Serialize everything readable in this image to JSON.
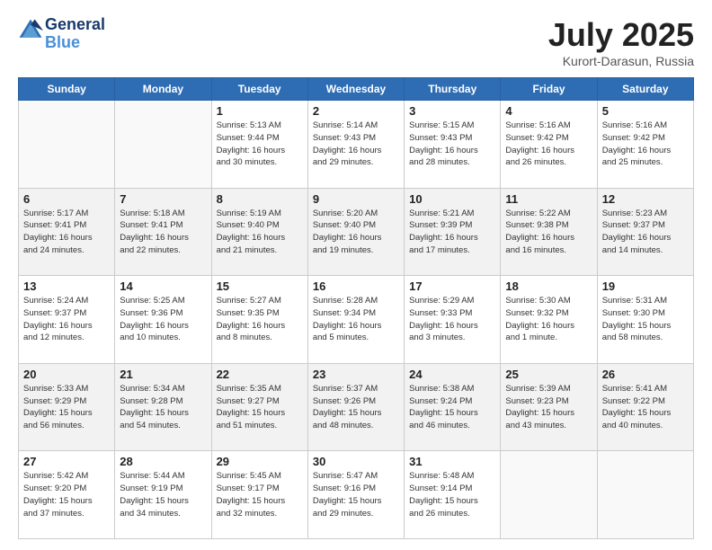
{
  "header": {
    "logo_line1": "General",
    "logo_line2": "Blue",
    "month": "July 2025",
    "location": "Kurort-Darasun, Russia"
  },
  "weekdays": [
    "Sunday",
    "Monday",
    "Tuesday",
    "Wednesday",
    "Thursday",
    "Friday",
    "Saturday"
  ],
  "weeks": [
    [
      {
        "day": "",
        "info": ""
      },
      {
        "day": "",
        "info": ""
      },
      {
        "day": "1",
        "info": "Sunrise: 5:13 AM\nSunset: 9:44 PM\nDaylight: 16 hours\nand 30 minutes."
      },
      {
        "day": "2",
        "info": "Sunrise: 5:14 AM\nSunset: 9:43 PM\nDaylight: 16 hours\nand 29 minutes."
      },
      {
        "day": "3",
        "info": "Sunrise: 5:15 AM\nSunset: 9:43 PM\nDaylight: 16 hours\nand 28 minutes."
      },
      {
        "day": "4",
        "info": "Sunrise: 5:16 AM\nSunset: 9:42 PM\nDaylight: 16 hours\nand 26 minutes."
      },
      {
        "day": "5",
        "info": "Sunrise: 5:16 AM\nSunset: 9:42 PM\nDaylight: 16 hours\nand 25 minutes."
      }
    ],
    [
      {
        "day": "6",
        "info": "Sunrise: 5:17 AM\nSunset: 9:41 PM\nDaylight: 16 hours\nand 24 minutes."
      },
      {
        "day": "7",
        "info": "Sunrise: 5:18 AM\nSunset: 9:41 PM\nDaylight: 16 hours\nand 22 minutes."
      },
      {
        "day": "8",
        "info": "Sunrise: 5:19 AM\nSunset: 9:40 PM\nDaylight: 16 hours\nand 21 minutes."
      },
      {
        "day": "9",
        "info": "Sunrise: 5:20 AM\nSunset: 9:40 PM\nDaylight: 16 hours\nand 19 minutes."
      },
      {
        "day": "10",
        "info": "Sunrise: 5:21 AM\nSunset: 9:39 PM\nDaylight: 16 hours\nand 17 minutes."
      },
      {
        "day": "11",
        "info": "Sunrise: 5:22 AM\nSunset: 9:38 PM\nDaylight: 16 hours\nand 16 minutes."
      },
      {
        "day": "12",
        "info": "Sunrise: 5:23 AM\nSunset: 9:37 PM\nDaylight: 16 hours\nand 14 minutes."
      }
    ],
    [
      {
        "day": "13",
        "info": "Sunrise: 5:24 AM\nSunset: 9:37 PM\nDaylight: 16 hours\nand 12 minutes."
      },
      {
        "day": "14",
        "info": "Sunrise: 5:25 AM\nSunset: 9:36 PM\nDaylight: 16 hours\nand 10 minutes."
      },
      {
        "day": "15",
        "info": "Sunrise: 5:27 AM\nSunset: 9:35 PM\nDaylight: 16 hours\nand 8 minutes."
      },
      {
        "day": "16",
        "info": "Sunrise: 5:28 AM\nSunset: 9:34 PM\nDaylight: 16 hours\nand 5 minutes."
      },
      {
        "day": "17",
        "info": "Sunrise: 5:29 AM\nSunset: 9:33 PM\nDaylight: 16 hours\nand 3 minutes."
      },
      {
        "day": "18",
        "info": "Sunrise: 5:30 AM\nSunset: 9:32 PM\nDaylight: 16 hours\nand 1 minute."
      },
      {
        "day": "19",
        "info": "Sunrise: 5:31 AM\nSunset: 9:30 PM\nDaylight: 15 hours\nand 58 minutes."
      }
    ],
    [
      {
        "day": "20",
        "info": "Sunrise: 5:33 AM\nSunset: 9:29 PM\nDaylight: 15 hours\nand 56 minutes."
      },
      {
        "day": "21",
        "info": "Sunrise: 5:34 AM\nSunset: 9:28 PM\nDaylight: 15 hours\nand 54 minutes."
      },
      {
        "day": "22",
        "info": "Sunrise: 5:35 AM\nSunset: 9:27 PM\nDaylight: 15 hours\nand 51 minutes."
      },
      {
        "day": "23",
        "info": "Sunrise: 5:37 AM\nSunset: 9:26 PM\nDaylight: 15 hours\nand 48 minutes."
      },
      {
        "day": "24",
        "info": "Sunrise: 5:38 AM\nSunset: 9:24 PM\nDaylight: 15 hours\nand 46 minutes."
      },
      {
        "day": "25",
        "info": "Sunrise: 5:39 AM\nSunset: 9:23 PM\nDaylight: 15 hours\nand 43 minutes."
      },
      {
        "day": "26",
        "info": "Sunrise: 5:41 AM\nSunset: 9:22 PM\nDaylight: 15 hours\nand 40 minutes."
      }
    ],
    [
      {
        "day": "27",
        "info": "Sunrise: 5:42 AM\nSunset: 9:20 PM\nDaylight: 15 hours\nand 37 minutes."
      },
      {
        "day": "28",
        "info": "Sunrise: 5:44 AM\nSunset: 9:19 PM\nDaylight: 15 hours\nand 34 minutes."
      },
      {
        "day": "29",
        "info": "Sunrise: 5:45 AM\nSunset: 9:17 PM\nDaylight: 15 hours\nand 32 minutes."
      },
      {
        "day": "30",
        "info": "Sunrise: 5:47 AM\nSunset: 9:16 PM\nDaylight: 15 hours\nand 29 minutes."
      },
      {
        "day": "31",
        "info": "Sunrise: 5:48 AM\nSunset: 9:14 PM\nDaylight: 15 hours\nand 26 minutes."
      },
      {
        "day": "",
        "info": ""
      },
      {
        "day": "",
        "info": ""
      }
    ]
  ]
}
